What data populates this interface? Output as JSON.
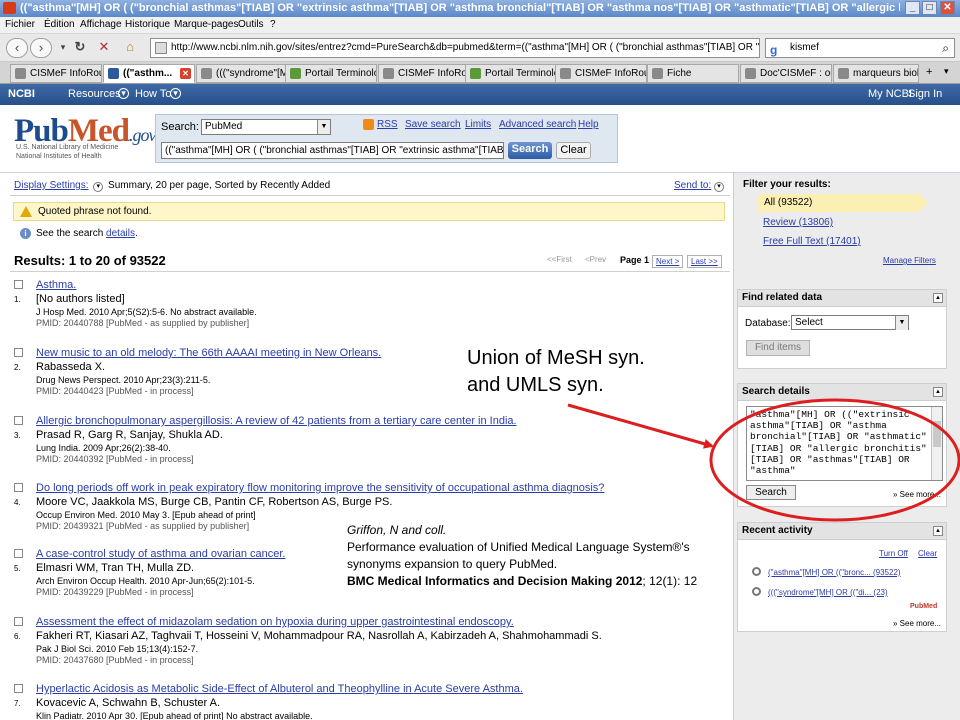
{
  "window": {
    "title": "((\"asthma\"[MH] OR ( (\"bronchial asthmas\"[TIAB] OR \"extrinsic asthma\"[TIAB] OR \"asthma bronchial\"[TIAB] OR \"asthma nos\"[TIAB] OR \"asthmatic\"[TIAB] OR \"allergic bronchitis\"[TIAB] OR \"asthmas\"[TIAB] O..."
  },
  "menu": [
    "Fichier",
    "Édition",
    "Affichage",
    "Historique",
    "Marque-pages",
    "Outils",
    "?"
  ],
  "nav": {
    "url": "http://www.ncbi.nlm.nih.gov/sites/entrez?cmd=PureSearch&db=pubmed&term=((\"asthma\"[MH] OR ( (\"bronchial asthmas\"[TIAB] OR \"extrinsic asthm",
    "search": "kismef"
  },
  "tabs": [
    "CISMeF InfoRoute",
    "((\"asthm...",
    "(((\"syndrome\"[M...",
    "Portail Terminolo...",
    "CISMeF InfoRoute",
    "Portail Terminolo...",
    "CISMeF InfoRoute",
    "Fiche",
    "Doc'CISMeF : ou...",
    "marqueurs biolo..."
  ],
  "ncbi": {
    "logo": "NCBI",
    "resources": "Resources",
    "howto": "How To",
    "myncbi": "My NCBI",
    "signin": "Sign In"
  },
  "pubmed": {
    "logo_a": "Pub",
    "logo_b": "Med",
    "logo_gov": ".gov",
    "sub1": "U.S. National Library of Medicine",
    "sub2": "National Institutes of Health",
    "search_label": "Search:",
    "db": "PubMed",
    "query": "((\"asthma\"[MH] OR ( (\"bronchial asthmas\"[TIAB] OR \"extrinsic asthma\"[TIAB]",
    "search_btn": "Search",
    "clear_btn": "Clear",
    "links": {
      "rss": "RSS",
      "save": "Save search",
      "limits": "Limits",
      "advanced": "Advanced search",
      "help": "Help"
    }
  },
  "results_bar": {
    "display": "Display Settings:",
    "display_value": "Summary, 20 per page, Sorted by Recently Added",
    "sendto": "Send to:",
    "warning": "Quoted phrase not found.",
    "see_pre": "See the search ",
    "see_link": "details",
    "see_post": ".",
    "results_header": "Results: 1 to 20 of 93522",
    "pager": {
      "first": "<<First",
      "prev": "<Prev",
      "page": "Page 1",
      "next": "Next >",
      "last": "Last >>"
    }
  },
  "results": [
    {
      "n": "1.",
      "title": "Asthma.",
      "authors": "[No authors listed]",
      "source": "J Hosp Med. 2010 Apr;5(S2):5-6. No abstract available.",
      "pmid": "PMID: 20440788 [PubMed - as supplied by publisher]"
    },
    {
      "n": "2.",
      "title": "New music to an old melody: The 66th AAAAI meeting in New Orleans.",
      "authors": "Rabasseda X.",
      "source": "Drug News Perspect. 2010 Apr;23(3):211-5.",
      "pmid": "PMID: 20440423 [PubMed - in process]"
    },
    {
      "n": "3.",
      "title": "Allergic bronchopulmonary aspergillosis: A review of 42 patients from a tertiary care center in India.",
      "authors": "Prasad R, Garg R, Sanjay, Shukla AD.",
      "source": "Lung India. 2009 Apr;26(2):38-40.",
      "pmid": "PMID: 20440392 [PubMed - in process]"
    },
    {
      "n": "4.",
      "title": "Do long periods off work in peak expiratory flow monitoring improve the sensitivity of occupational asthma diagnosis?",
      "authors": "Moore VC, Jaakkola MS, Burge CB, Pantin CF, Robertson AS, Burge PS.",
      "source": "Occup Environ Med. 2010 May 3. [Epub ahead of print]",
      "pmid": "PMID: 20439321 [PubMed - as supplied by publisher]"
    },
    {
      "n": "5.",
      "title": "A case-control study of asthma and ovarian cancer.",
      "authors": "Elmasri WM, Tran TH, Mulla ZD.",
      "source": "Arch Environ Occup Health. 2010 Apr-Jun;65(2):101-5.",
      "pmid": "PMID: 20439229 [PubMed - in process]"
    },
    {
      "n": "6.",
      "title": "Assessment the effect of midazolam sedation on hypoxia during upper gastrointestinal endoscopy.",
      "authors": "Fakheri RT, Kiasari AZ, Taghvaii T, Hosseini V, Mohammadpour RA, Nasrollah A, Kabirzadeh A, Shahmohammadi S.",
      "source": "Pak J Biol Sci. 2010 Feb 15;13(4):152-7.",
      "pmid": "PMID: 20437680 [PubMed - in process]"
    },
    {
      "n": "7.",
      "title": "Hyperlactic Acidosis as Metabolic Side-Effect of Albuterol and Theophylline in Acute Severe Asthma.",
      "authors": "Kovacevic A, Schwahn B, Schuster A.",
      "source": "Klin Padiatr. 2010 Apr 30. [Epub ahead of print] No abstract available.",
      "pmid": ""
    }
  ],
  "filters": {
    "header": "Filter your results:",
    "all": "All (93522)",
    "review": "Review (13806)",
    "fulltext": "Free Full Text (17401)",
    "manage": "Manage Filters"
  },
  "related": {
    "header": "Find related data",
    "db_label": "Database:",
    "db_value": "Select",
    "find": "Find items"
  },
  "details": {
    "header": "Search details",
    "text": "\"asthma\"[MH] OR ((\"extrinsic asthma\"[TIAB] OR \"asthma bronchial\"[TIAB] OR \"asthmatic\"[TIAB] OR \"allergic bronchitis\"[TIAB] OR \"asthmas\"[TIAB] OR \"asthma\"",
    "search": "Search",
    "seemore": "» See more..."
  },
  "recent": {
    "header": "Recent activity",
    "turnoff": "Turn Off",
    "clear": "Clear",
    "item1": "(\"asthma\"[MH] OR ((\"bronc... (93522)",
    "item2": "(((\"syndrome\"[MH] OR ((\"di... (23)",
    "pubmed_label": "PubMed",
    "seemore": "» See more..."
  },
  "annotation": {
    "line1": "Union of MeSH syn.",
    "line2": "and UMLS syn."
  },
  "citation": {
    "line1": "Griffon, N and coll.",
    "line2": "Performance evaluation of Unified Medical Language System®'s",
    "line3": "synonyms expansion to query PubMed.",
    "line4_bold": "BMC Medical Informatics and Decision Making 2012",
    "line4_rest": "; 12(1): 12"
  },
  "colors": {
    "annotation_red": "#dd1e1e",
    "link": "#2b3da8",
    "ncbi_bar": "#27508a",
    "warning_bg": "#fff7c9"
  }
}
